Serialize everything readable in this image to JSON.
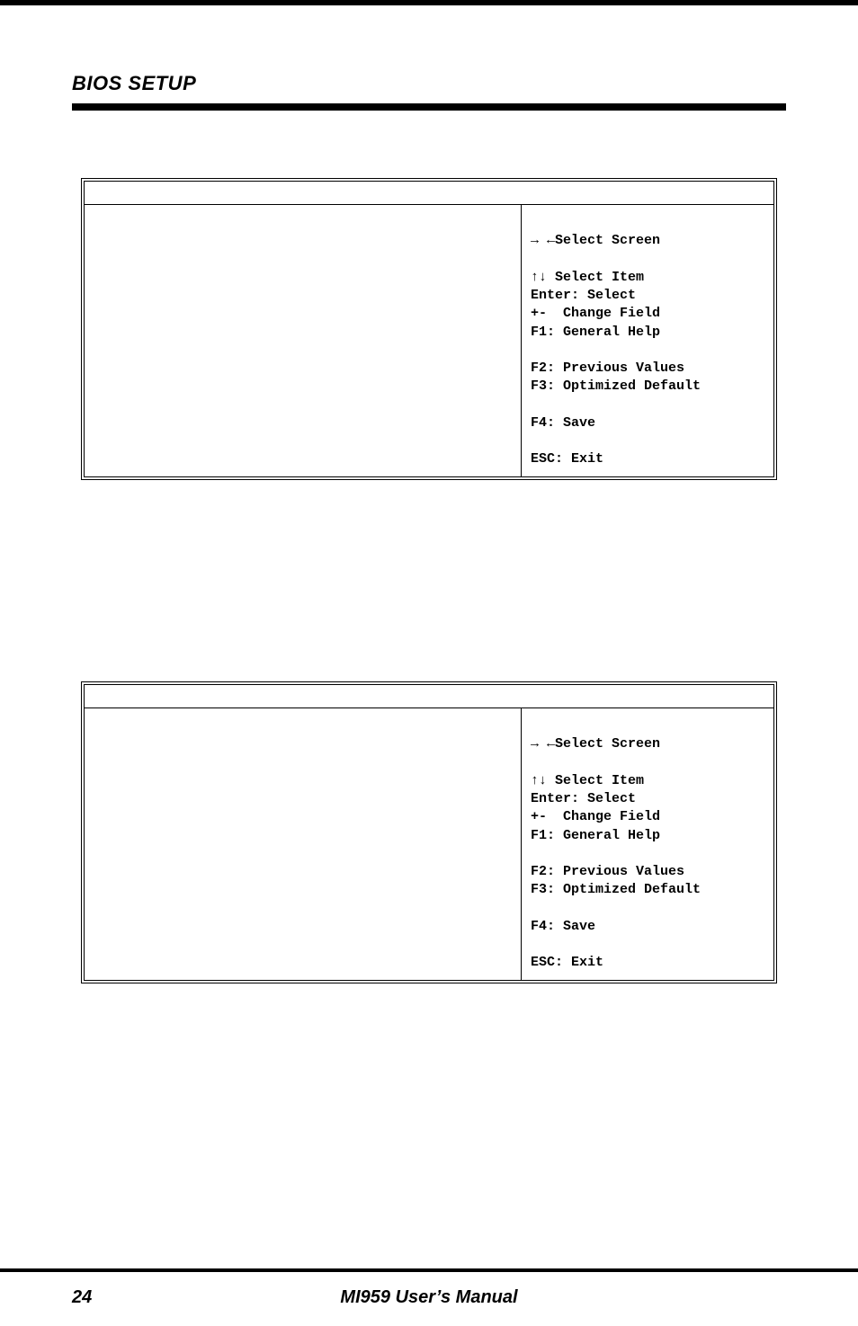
{
  "header": {
    "title": "BIOS SETUP"
  },
  "help_panel": {
    "line1": "→ ←Select Screen",
    "line2": "↑↓ Select Item",
    "line3": "Enter: Select",
    "line4": "+-  Change Field",
    "line5": "F1: General Help",
    "line6": "F2: Previous Values",
    "line7": "F3: Optimized Default",
    "line8": "F4: Save",
    "line9": "ESC: Exit"
  },
  "footer": {
    "page": "24",
    "manual": "MI959 User’s Manual"
  }
}
